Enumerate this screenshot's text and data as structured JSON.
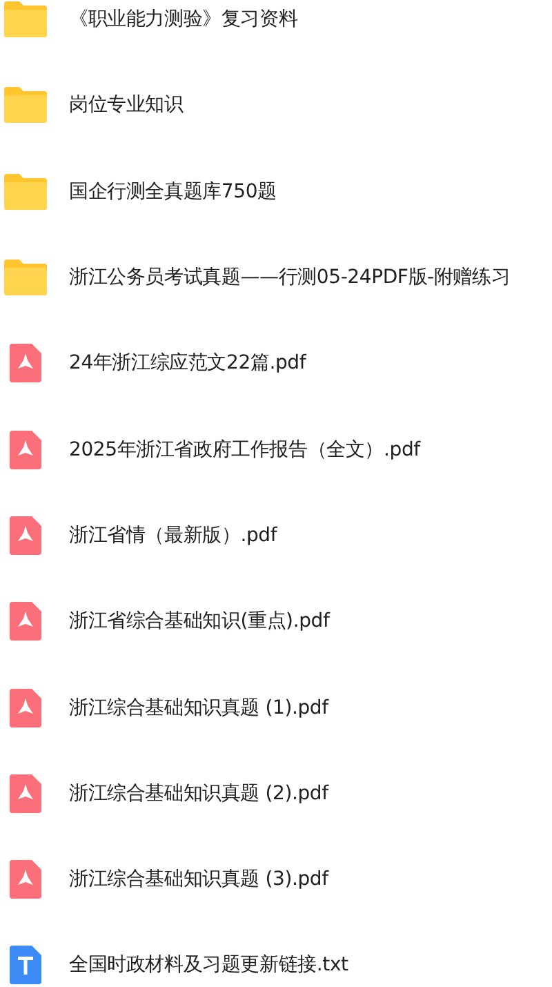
{
  "files": [
    {
      "kind": "folder",
      "name": "《职业能力测验》复习资料"
    },
    {
      "kind": "folder",
      "name": "岗位专业知识"
    },
    {
      "kind": "folder",
      "name": "国企行测全真题库750题"
    },
    {
      "kind": "folder",
      "name": "浙江公务员考试真题——行测05-24PDF版-附赠练习"
    },
    {
      "kind": "pdf",
      "name": "24年浙江综应范文22篇.pdf"
    },
    {
      "kind": "pdf",
      "name": "2025年浙江省政府工作报告（全文）.pdf"
    },
    {
      "kind": "pdf",
      "name": "浙江省情（最新版）.pdf"
    },
    {
      "kind": "pdf",
      "name": "浙江省综合基础知识(重点).pdf"
    },
    {
      "kind": "pdf",
      "name": "浙江综合基础知识真题 (1).pdf"
    },
    {
      "kind": "pdf",
      "name": "浙江综合基础知识真题 (2).pdf"
    },
    {
      "kind": "pdf",
      "name": "浙江综合基础知识真题 (3).pdf"
    },
    {
      "kind": "txt",
      "name": "全国时政材料及习题更新链接.txt"
    }
  ]
}
